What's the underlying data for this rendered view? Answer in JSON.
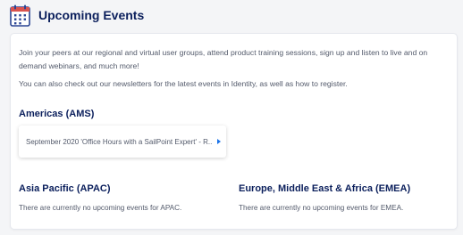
{
  "header": {
    "title": "Upcoming Events",
    "icon": "calendar-icon",
    "accent_color": "#2b4593",
    "icon_top_color": "#d9534f"
  },
  "intro": {
    "paragraph1": "Join your peers at our regional and virtual user groups, attend product training sessions, sign up and listen to live and on demand webinars, and much more!",
    "paragraph2": "You can also check out our newsletters for the latest events in Identity, as well as how to register."
  },
  "regions": {
    "americas": {
      "title": "Americas (AMS)",
      "event_title": "September 2020 'Office Hours with a SailPoint Expert' - R..."
    },
    "apac": {
      "title": "Asia Pacific (APAC)",
      "empty_text": "There are currently no upcoming events for APAC."
    },
    "emea": {
      "title": "Europe, Middle East & Africa (EMEA)",
      "empty_text": "There are currently no upcoming events for EMEA."
    }
  }
}
